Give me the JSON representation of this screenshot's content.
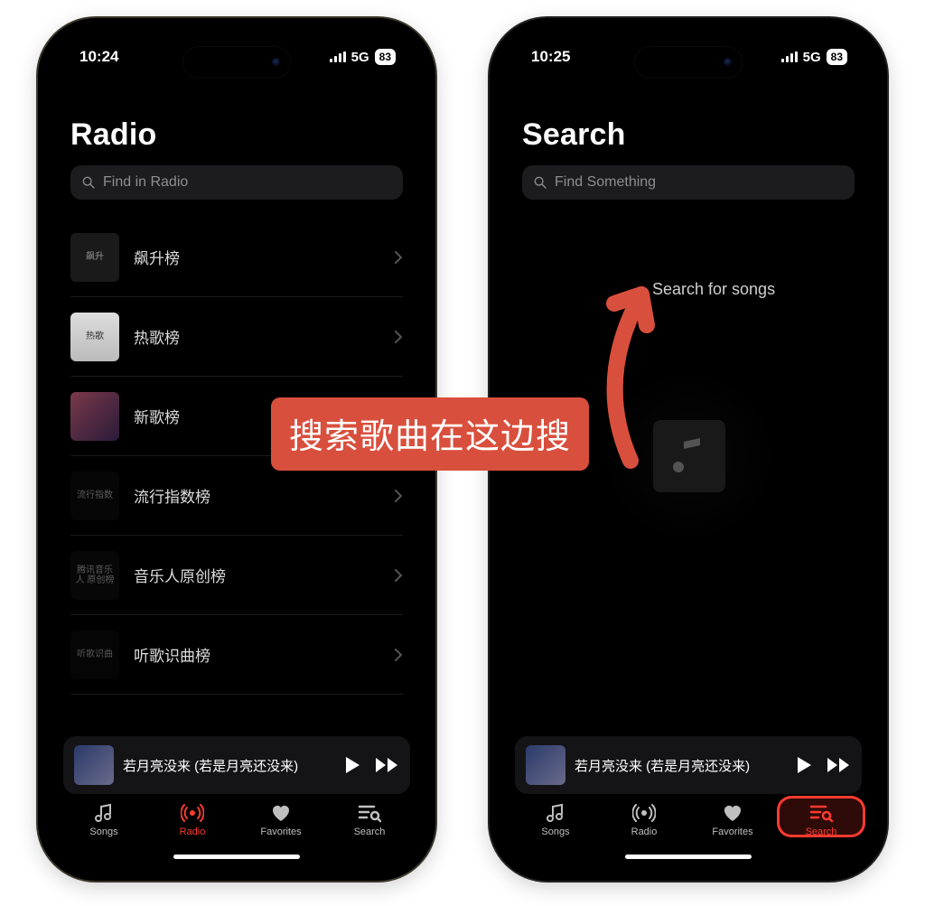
{
  "callout": "搜索歌曲在这边搜",
  "status": {
    "network": "5G",
    "battery": "83"
  },
  "left": {
    "time": "10:24",
    "title": "Radio",
    "search_placeholder": "Find in Radio",
    "rows": [
      {
        "title": "飙升榜",
        "thumb_label": "飙升"
      },
      {
        "title": "热歌榜",
        "thumb_label": "热歌"
      },
      {
        "title": "新歌榜",
        "thumb_label": ""
      },
      {
        "title": "流行指数榜",
        "thumb_label": "流行指数"
      },
      {
        "title": "音乐人原创榜",
        "thumb_label": "腾讯音乐人\n原创榜"
      },
      {
        "title": "听歌识曲榜",
        "thumb_label": "听歌识曲"
      }
    ],
    "now_playing": "若月亮没来 (若是月亮还没来)",
    "tabs": [
      {
        "label": "Songs"
      },
      {
        "label": "Radio"
      },
      {
        "label": "Favorites"
      },
      {
        "label": "Search"
      }
    ],
    "active_tab": 1
  },
  "right": {
    "time": "10:25",
    "title": "Search",
    "search_placeholder": "Find Something",
    "hint": "Search for songs",
    "now_playing": "若月亮没来 (若是月亮还没来)",
    "tabs": [
      {
        "label": "Songs"
      },
      {
        "label": "Radio"
      },
      {
        "label": "Favorites"
      },
      {
        "label": "Search"
      }
    ],
    "active_tab": 3
  }
}
